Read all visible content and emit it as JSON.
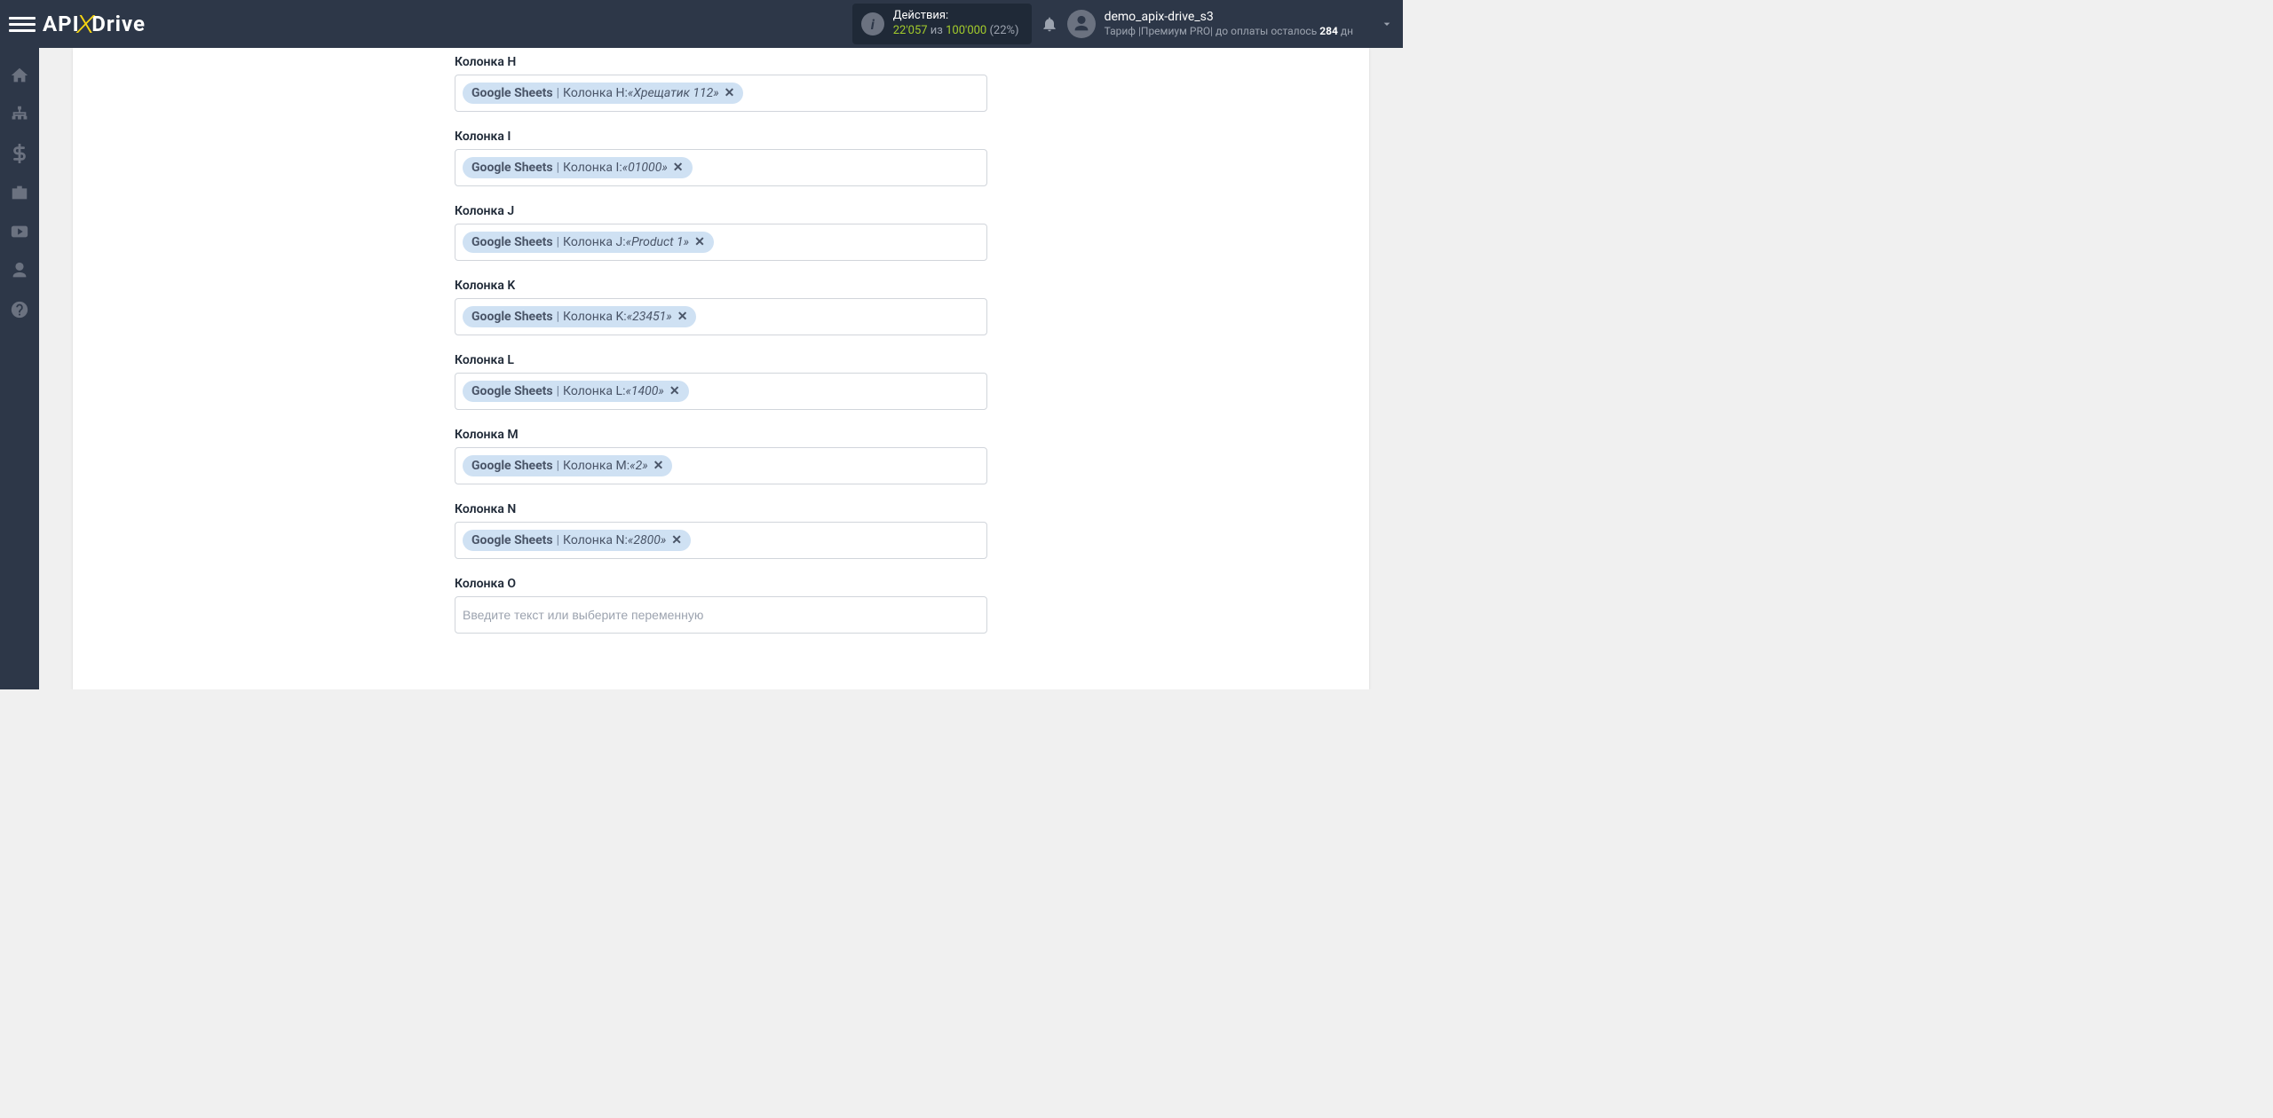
{
  "header": {
    "logo": {
      "api": "API",
      "x": "X",
      "drive": "Drive"
    },
    "actions": {
      "label": "Действия:",
      "count": "22'057",
      "sep": " из ",
      "total": "100'000",
      "pct": " (22%)"
    },
    "user": {
      "name": "demo_apix-drive_s3",
      "sub_prefix": "Тариф |Премиум PRO| до оплаты осталось ",
      "sub_days": "284",
      "sub_suffix": " дн"
    }
  },
  "fields": [
    {
      "label": "Колонка H",
      "src": "Google Sheets",
      "col": "Колонка H:",
      "val": "«Хрещатик 112»"
    },
    {
      "label": "Колонка I",
      "src": "Google Sheets",
      "col": "Колонка I:",
      "val": "«01000»"
    },
    {
      "label": "Колонка J",
      "src": "Google Sheets",
      "col": "Колонка J:",
      "val": "«Product 1»"
    },
    {
      "label": "Колонка K",
      "src": "Google Sheets",
      "col": "Колонка K:",
      "val": "«23451»"
    },
    {
      "label": "Колонка L",
      "src": "Google Sheets",
      "col": "Колонка L:",
      "val": "«1400»"
    },
    {
      "label": "Колонка M",
      "src": "Google Sheets",
      "col": "Колонка M:",
      "val": "«2»"
    },
    {
      "label": "Колонка N",
      "src": "Google Sheets",
      "col": "Колонка N:",
      "val": "«2800»"
    }
  ],
  "empty_field": {
    "label": "Колонка O",
    "placeholder": "Введите текст или выберите переменную"
  }
}
